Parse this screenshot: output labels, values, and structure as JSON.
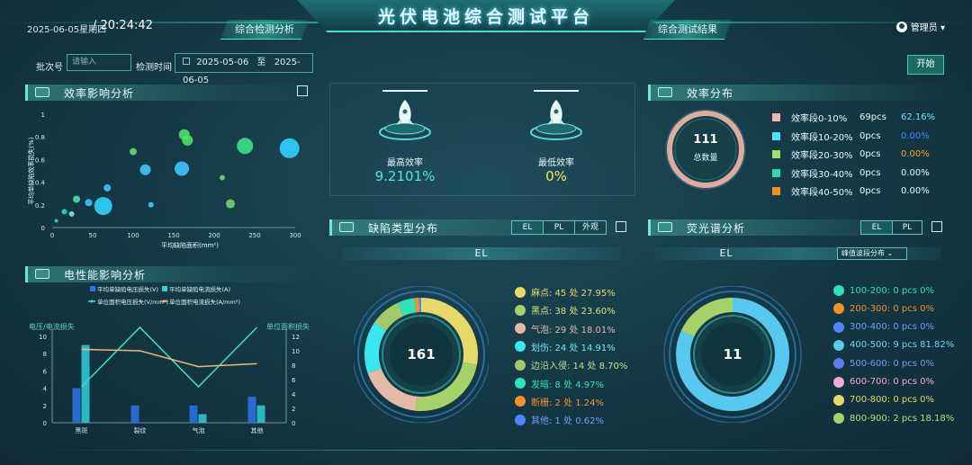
{
  "header": {
    "title": "光伏电池综合测试平台",
    "date": "2025-06-05星期四",
    "time": "/ 20:24:42",
    "tabs": [
      {
        "label": "综合检测分析"
      },
      {
        "label": "综合测试结果"
      }
    ],
    "user": "管理员 ▾"
  },
  "filter": {
    "batch_label": "批次号",
    "batch_placeholder": "请输入",
    "time_label": "检测时间",
    "date_from": "2025-05-06",
    "date_sep": "至",
    "date_to": "2025-06-05",
    "start_button": "开始"
  },
  "panels": {
    "efficiency_impact": {
      "title": "效率影响分析"
    },
    "electrical_impact": {
      "title": "电性能影响分析"
    },
    "efficiency_dist": {
      "title": "效率分布"
    },
    "defect_types": {
      "title": "缺陷类型分布",
      "tabs": [
        "EL",
        "PL",
        "外观"
      ],
      "sub": "EL"
    },
    "fluorescence": {
      "title": "荧光谱分析",
      "tabs": [
        "EL",
        "PL"
      ],
      "sub": "EL",
      "select": "峰值波段分布 ⌄"
    }
  },
  "stats": {
    "max_label": "最高效率",
    "max_value": "9.2101%",
    "min_label": "最低效率",
    "min_value": "0%"
  },
  "efficiency_dist": {
    "total": "111",
    "total_label": "总数量",
    "rows": [
      {
        "label": "效率段0-10%",
        "count": "69pcs",
        "pct": "62.16%",
        "color": "#f3b8a8",
        "pct_color": "#5fe6ff"
      },
      {
        "label": "效率段10-20%",
        "count": "0pcs",
        "pct": "0.00%",
        "color": "#4de3ff",
        "pct_color": "#3f8bff"
      },
      {
        "label": "效率段20-30%",
        "count": "0pcs",
        "pct": "0.00%",
        "color": "#a2e063",
        "pct_color": "#f5a323"
      },
      {
        "label": "效率段30-40%",
        "count": "0pcs",
        "pct": "0.00%",
        "color": "#2fd9a8",
        "pct_color": "#e8fbff"
      },
      {
        "label": "效率段40-50%",
        "count": "0pcs",
        "pct": "0.00%",
        "color": "#f0901e",
        "pct_color": "#e8fbff"
      }
    ]
  },
  "defects": {
    "total": "161",
    "rows": [
      {
        "text": "麻点: 45 处  27.95%",
        "color": "#e7d86a",
        "text_color": "#e7d86a"
      },
      {
        "text": "黑点: 38 处  23.60%",
        "color": "#a6d26a",
        "text_color": "#d9e27a"
      },
      {
        "text": "气泡: 29 处  18.01%",
        "color": "#e4b9a8",
        "text_color": "#e4b9a8"
      },
      {
        "text": "划伤: 24 处  14.91%",
        "color": "#3de7ef",
        "text_color": "#6fe9f3"
      },
      {
        "text": "边沿入侵: 14 处  8.70%",
        "color": "#a3c96b",
        "text_color": "#c2df8a"
      },
      {
        "text": "发暗: 8 处  4.97%",
        "color": "#33e2b8",
        "text_color": "#33e2b8"
      },
      {
        "text": "断栅: 2 处  1.24%",
        "color": "#f5902a",
        "text_color": "#f5902a"
      },
      {
        "text": "其他: 1 处  0.62%",
        "color": "#4f86ff",
        "text_color": "#6fa0ff"
      }
    ]
  },
  "spectrum": {
    "total": "11",
    "rows": [
      {
        "text": "100-200: 0 pcs  0%",
        "color": "#2fe2b8",
        "text_color": "#2fe2b8"
      },
      {
        "text": "200-300: 0 pcs  0%",
        "color": "#f5902a",
        "text_color": "#f5902a"
      },
      {
        "text": "300-400: 0 pcs  0%",
        "color": "#4f86ff",
        "text_color": "#6f9dff"
      },
      {
        "text": "400-500: 9 pcs  81.82%",
        "color": "#58c8f0",
        "text_color": "#6fd4f5"
      },
      {
        "text": "500-600: 0 pcs  0%",
        "color": "#5b7cf0",
        "text_color": "#7f95f3"
      },
      {
        "text": "600-700: 0 pcs  0%",
        "color": "#f3a9d8",
        "text_color": "#f3a9d8"
      },
      {
        "text": "700-800: 0 pcs  0%",
        "color": "#e8d66b",
        "text_color": "#e8d66b"
      },
      {
        "text": "800-900: 2 pcs  18.18%",
        "color": "#a6d26a",
        "text_color": "#b9df7d"
      }
    ]
  },
  "chart_data": [
    {
      "type": "scatter",
      "title": "效率影响分析",
      "xlabel": "平均缺陷面积(mm²)",
      "ylabel": "平均单缺陷效率损失(%)",
      "xlim": [
        0,
        300
      ],
      "ylim": [
        0,
        1
      ],
      "xticks": [
        "0",
        "50",
        "100",
        "150",
        "200",
        "250",
        "300"
      ],
      "yticks": [
        "0",
        "0.2",
        "0.4",
        "0.6",
        "0.8",
        "1"
      ],
      "points": [
        {
          "x": 5,
          "y": 0.06,
          "r": 2,
          "color": "#26d7c9"
        },
        {
          "x": 15,
          "y": 0.14,
          "r": 3,
          "color": "#26d7c9"
        },
        {
          "x": 24,
          "y": 0.12,
          "r": 3,
          "color": "#7be5d6"
        },
        {
          "x": 30,
          "y": 0.25,
          "r": 4,
          "color": "#46e0a8"
        },
        {
          "x": 45,
          "y": 0.22,
          "r": 4,
          "color": "#3ec7ff"
        },
        {
          "x": 63,
          "y": 0.19,
          "r": 10,
          "color": "#2fd3ff"
        },
        {
          "x": 68,
          "y": 0.35,
          "r": 4,
          "color": "#3ec7ff"
        },
        {
          "x": 100,
          "y": 0.67,
          "r": 4,
          "color": "#6ad86f"
        },
        {
          "x": 115,
          "y": 0.51,
          "r": 6,
          "color": "#3ec7ff"
        },
        {
          "x": 122,
          "y": 0.2,
          "r": 3,
          "color": "#3ec7ff"
        },
        {
          "x": 160,
          "y": 0.52,
          "r": 8,
          "color": "#3ec7ff"
        },
        {
          "x": 163,
          "y": 0.82,
          "r": 6,
          "color": "#4be06a"
        },
        {
          "x": 167,
          "y": 0.77,
          "r": 6,
          "color": "#4be06a"
        },
        {
          "x": 210,
          "y": 0.44,
          "r": 3,
          "color": "#6ad86f"
        },
        {
          "x": 220,
          "y": 0.21,
          "r": 5,
          "color": "#6ad86f"
        },
        {
          "x": 238,
          "y": 0.72,
          "r": 9,
          "color": "#3ee08a"
        },
        {
          "x": 293,
          "y": 0.7,
          "r": 11,
          "color": "#2fd3ff"
        }
      ]
    },
    {
      "type": "bar",
      "title": "电性能影响分析",
      "categories": [
        "黑斑",
        "裂纹",
        "气泡",
        "其他"
      ],
      "left_axis_label": "电压/电流损失",
      "right_axis_label": "单位面积损失",
      "ylim_left": [
        0,
        10
      ],
      "ylim_right": [
        0,
        12
      ],
      "yticks_left": [
        "0",
        "2",
        "4",
        "6",
        "8",
        "10"
      ],
      "yticks_right": [
        "0",
        "2",
        "4",
        "6",
        "8",
        "10",
        "12"
      ],
      "series": [
        {
          "name": "平均单缺陷电压损失(V)",
          "kind": "bar",
          "axis": "left",
          "color": "#2f74e8",
          "values": [
            4,
            2,
            2,
            3
          ]
        },
        {
          "name": "平均单缺陷电流损失(A)",
          "kind": "bar",
          "axis": "left",
          "color": "#2fd1d6",
          "values": [
            9,
            0,
            1,
            2
          ]
        },
        {
          "name": "单位面积电压损失(V/mm²)",
          "kind": "line",
          "axis": "right",
          "color": "#3de0c4",
          "values": [
            5,
            15,
            5,
            15
          ]
        },
        {
          "name": "单位面积电流损失(A/mm²)",
          "kind": "line",
          "axis": "right",
          "color": "#f0b47a",
          "values": [
            10.2,
            10,
            7.8,
            8.2
          ]
        }
      ]
    },
    {
      "type": "pie",
      "title": "缺陷类型分布",
      "categories": [
        "麻点",
        "黑点",
        "气泡",
        "划伤",
        "边沿入侵",
        "发暗",
        "断栅",
        "其他"
      ],
      "values": [
        45,
        38,
        29,
        24,
        14,
        8,
        2,
        1
      ]
    },
    {
      "type": "pie",
      "title": "荧光谱分析",
      "categories": [
        "100-200",
        "200-300",
        "300-400",
        "400-500",
        "500-600",
        "600-700",
        "700-800",
        "800-900"
      ],
      "values": [
        0,
        0,
        0,
        9,
        0,
        0,
        0,
        2
      ]
    },
    {
      "type": "pie",
      "title": "效率分布",
      "categories": [
        "效率段0-10%",
        "效率段10-20%",
        "效率段20-30%",
        "效率段30-40%",
        "效率段40-50%"
      ],
      "values": [
        69,
        0,
        0,
        0,
        0
      ]
    }
  ]
}
